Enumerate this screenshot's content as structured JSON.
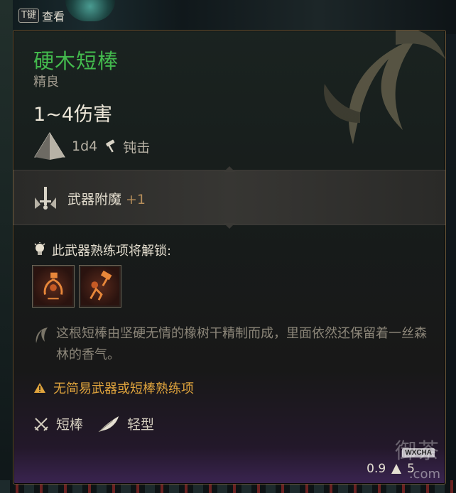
{
  "hotkey": {
    "key": "T键",
    "label": "查看"
  },
  "item": {
    "name": "硬木短棒",
    "rarity": "精良",
    "damage": "1~4伤害",
    "dice": "1d4",
    "damage_type": "钝击",
    "name_color": "#43b94d"
  },
  "enchant": {
    "label": "武器附魔",
    "bonus": "+1"
  },
  "proficiency": {
    "header": "此武器熟练项将解锁:",
    "skills": [
      {
        "icon": "cleaving-slash-icon"
      },
      {
        "icon": "concussive-smash-icon"
      }
    ]
  },
  "description": "这根短棒由坚硬无情的橡树干精制而成，里面依然还保留着一丝森林的香气。",
  "warning": {
    "text": "无简易武器或短棒熟练项",
    "color": "#e0a43d"
  },
  "properties": [
    {
      "icon": "crossed-swords-icon",
      "label": "短棒"
    },
    {
      "icon": "feather-icon",
      "label": "轻型"
    }
  ],
  "footer": {
    "weight": "0.9",
    "price": "5"
  },
  "watermark": {
    "text": "御茶",
    "tag": "WXCHA",
    "domain": ".com"
  }
}
